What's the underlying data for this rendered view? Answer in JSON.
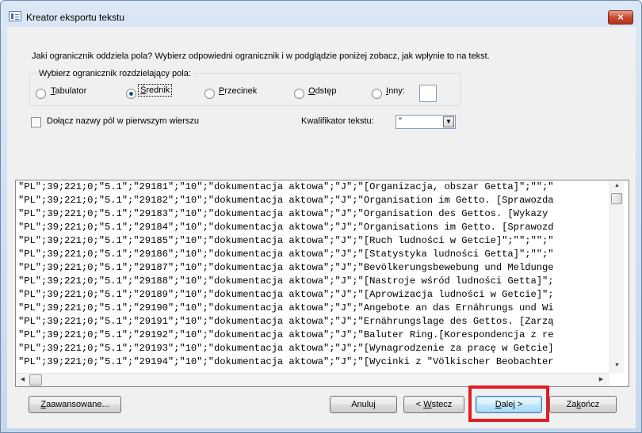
{
  "window": {
    "title": "Kreator eksportu tekstu",
    "close_glyph": "×"
  },
  "prompt": "Jaki ogranicznik oddziela pola? Wybierz odpowiedni ogranicznik i w podglądzie poniżej zobacz, jak wpłynie to na tekst.",
  "delimiter_group": {
    "legend": "Wybierz ogranicznik rozdzielający pola:",
    "options": [
      {
        "pre": "",
        "key": "T",
        "post": "abulator",
        "checked": false
      },
      {
        "pre": "",
        "key": "Ś",
        "post": "rednik",
        "checked": true
      },
      {
        "pre": "",
        "key": "P",
        "post": "rzecinek",
        "checked": false
      },
      {
        "pre": "",
        "key": "O",
        "post": "dstęp",
        "checked": false
      },
      {
        "pre": "",
        "key": "I",
        "post": "nny:",
        "checked": false
      }
    ],
    "other_value": ""
  },
  "include_field_names": {
    "label": "Dołącz nazwy pól w pierwszym wierszu",
    "checked": false
  },
  "text_qualifier": {
    "label": "Kwalifikator tekstu:",
    "value": "\""
  },
  "preview_lines": [
    "\"PL\";39;221;0;\"5.1\";\"29181\";\"10\";\"dokumentacja aktowa\";\"J\";\"[Organizacja, obszar Getta]\";\"\";\"",
    "\"PL\";39;221;0;\"5.1\";\"29182\";\"10\";\"dokumentacja aktowa\";\"J\";\"Organisation im Getto. [Sprawozda",
    "\"PL\";39;221;0;\"5.1\";\"29183\";\"10\";\"dokumentacja aktowa\";\"J\";\"Organisation des Gettos. [Wykazy",
    "\"PL\";39;221;0;\"5.1\";\"29184\";\"10\";\"dokumentacja aktowa\";\"J\";\"Organisations im Getto. [Sprawozd",
    "\"PL\";39;221;0;\"5.1\";\"29185\";\"10\";\"dokumentacja aktowa\";\"J\";\"[Ruch ludności w Getcie]\";\"\";\"\";\"",
    "\"PL\";39;221;0;\"5.1\";\"29186\";\"10\";\"dokumentacja aktowa\";\"J\";\"[Statystyka ludności Getta]\";\"\";\"",
    "\"PL\";39;221;0;\"5.1\";\"29187\";\"10\";\"dokumentacja aktowa\";\"J\";\"Bevölkerungsbewebung und Meldunge",
    "\"PL\";39;221;0;\"5.1\";\"29188\";\"10\";\"dokumentacja aktowa\";\"J\";\"[Nastroje wśród ludności Getta]\";",
    "\"PL\";39;221;0;\"5.1\";\"29189\";\"10\";\"dokumentacja aktowa\";\"J\";\"[Aprowizacja ludności w Getcie]\";",
    "\"PL\";39;221;0;\"5.1\";\"29190\";\"10\";\"dokumentacja aktowa\";\"J\";\"Angebote an das Ernährungs und Wi",
    "\"PL\";39;221;0;\"5.1\";\"29191\";\"10\";\"dokumentacja aktowa\";\"J\";\"Ernährungslage des Gettos. [Zarzą",
    "\"PL\";39;221;0;\"5.1\";\"29192\";\"10\";\"dokumentacja aktowa\";\"J\";\"Baluter Ring.[Korespondencja z re",
    "\"PL\";39;221;0;\"5.1\";\"29193\";\"10\";\"dokumentacja aktowa\";\"J\";\"[Wynagrodzenie za pracę w Getcie]",
    "\"PL\";39;221;0;\"5.1\";\"29194\";\"10\";\"dokumentacja aktowa\";\"J\";\"[Wycinki z \"Völkischer Beobachter"
  ],
  "scroll_glyphs": {
    "up": "▲",
    "down": "▼",
    "left": "◀",
    "right": "▶"
  },
  "combo_arrow": "▼",
  "buttons": {
    "advanced": {
      "pre": "",
      "key": "Z",
      "post": "aawansowane..."
    },
    "cancel": {
      "pre": "Anuluj",
      "key": "",
      "post": ""
    },
    "back": {
      "pre": "< ",
      "key": "W",
      "post": "stecz"
    },
    "next": {
      "pre": "",
      "key": "D",
      "post": "alej >"
    },
    "finish": {
      "pre": "Za",
      "key": "k",
      "post": "ończ"
    }
  },
  "colors": {
    "highlight": "#e11d24",
    "close": "#c74a2f"
  }
}
